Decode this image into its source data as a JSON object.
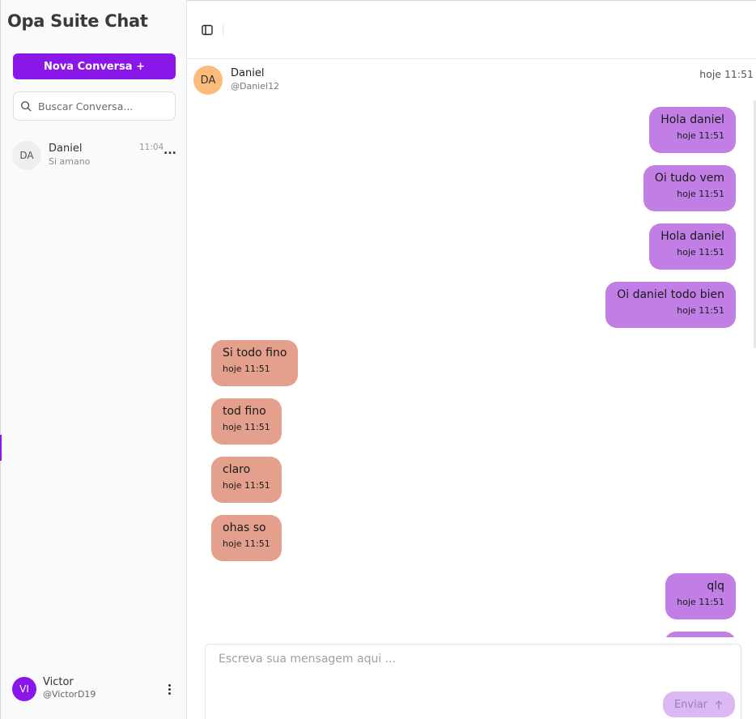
{
  "sidebar": {
    "app_title": "Opa Suite Chat",
    "new_chat_label": "Nova Conversa +",
    "search_placeholder": "Buscar Conversa...",
    "conversations": [
      {
        "initials": "DA",
        "name": "Daniel",
        "preview": "Si amano",
        "time": "11:04",
        "more": "..."
      }
    ],
    "user": {
      "initials": "VI",
      "name": "Victor",
      "handle": "@VictorD19"
    }
  },
  "chat": {
    "contact": {
      "initials": "DA",
      "name": "Daniel",
      "handle": "@Daniel12",
      "time": "hoje 11:51"
    },
    "messages": [
      {
        "direction": "out",
        "text": "Hola daniel",
        "time": "hoje 11:51"
      },
      {
        "direction": "out",
        "text": "Oi tudo vem",
        "time": "hoje 11:51"
      },
      {
        "direction": "out",
        "text": "Hola daniel",
        "time": "hoje 11:51"
      },
      {
        "direction": "out",
        "text": "Oi daniel todo bien",
        "time": "hoje 11:51"
      },
      {
        "direction": "in",
        "text": "Si todo fino",
        "time": "hoje 11:51"
      },
      {
        "direction": "in",
        "text": "tod fino",
        "time": "hoje 11:51"
      },
      {
        "direction": "in",
        "text": "claro",
        "time": "hoje 11:51"
      },
      {
        "direction": "in",
        "text": "ohas so",
        "time": "hoje 11:51"
      },
      {
        "direction": "out",
        "text": "qlq",
        "time": "hoje 11:51"
      }
    ],
    "composer": {
      "placeholder": "Escreva sua mensagem aqui ...",
      "send_label": "Enviar"
    }
  },
  "colors": {
    "accent": "#8a16e8",
    "outgoing_bubble": "#c17fe6",
    "incoming_bubble": "#e4a08c",
    "contact_avatar": "#fdbb7a",
    "send_button_disabled": "#dcb8f3"
  },
  "icons": {
    "search": "search-icon",
    "sidebar_toggle": "sidebar-toggle-icon",
    "conversation_menu": "more-horizontal-icon",
    "user_menu": "more-vertical-icon",
    "send": "arrow-up-icon"
  }
}
